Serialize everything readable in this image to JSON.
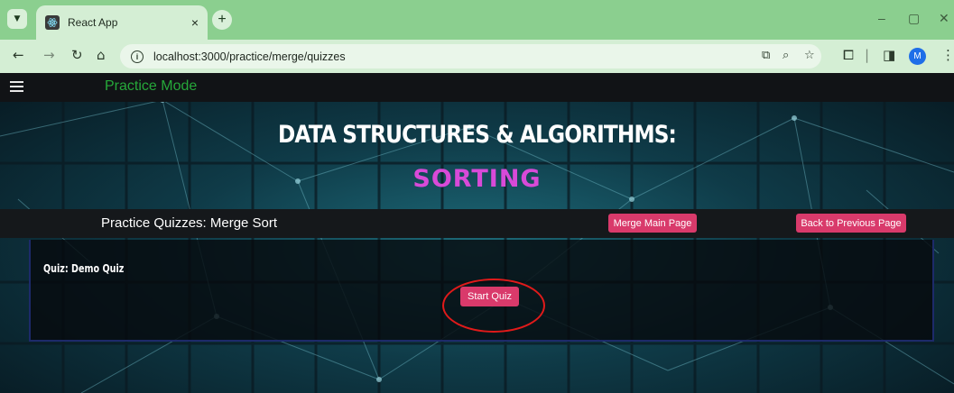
{
  "browser": {
    "tab_title": "React App",
    "tab_close": "×",
    "new_tab": "+",
    "url": "localhost:3000/practice/merge/quizzes",
    "profile_initial": "M",
    "window_controls": {
      "minimize": "–",
      "restore": "▢",
      "close": "✕"
    }
  },
  "app": {
    "mode_label": "Practice Mode",
    "hero_title": "DATA STRUCTURES & ALGORITHMS:",
    "hero_subtitle": "SORTING",
    "section_title": "Practice Quizzes: Merge Sort",
    "merge_main_button": "Merge Main Page",
    "back_button": "Back to Previous Page",
    "quiz": {
      "title": "Quiz: Demo Quiz",
      "start_button": "Start Quiz"
    }
  },
  "colors": {
    "tabbar": "#8bcf8f",
    "toolbar": "#d4eed4",
    "appbar": "#111316",
    "practice_mode_text": "#26a83a",
    "hero_subtitle": "#d84ad8",
    "button": "#d93a6b",
    "annotation_ellipse": "#e01a1a"
  },
  "icons": [
    "tab-dropdown-icon",
    "react-favicon-icon",
    "back-arrow-icon",
    "forward-arrow-icon",
    "reload-icon",
    "home-icon",
    "site-info-icon",
    "install-app-icon",
    "zoom-icon",
    "bookmark-star-icon",
    "extensions-icon",
    "side-panel-icon",
    "more-menu-icon",
    "hamburger-menu-icon"
  ]
}
